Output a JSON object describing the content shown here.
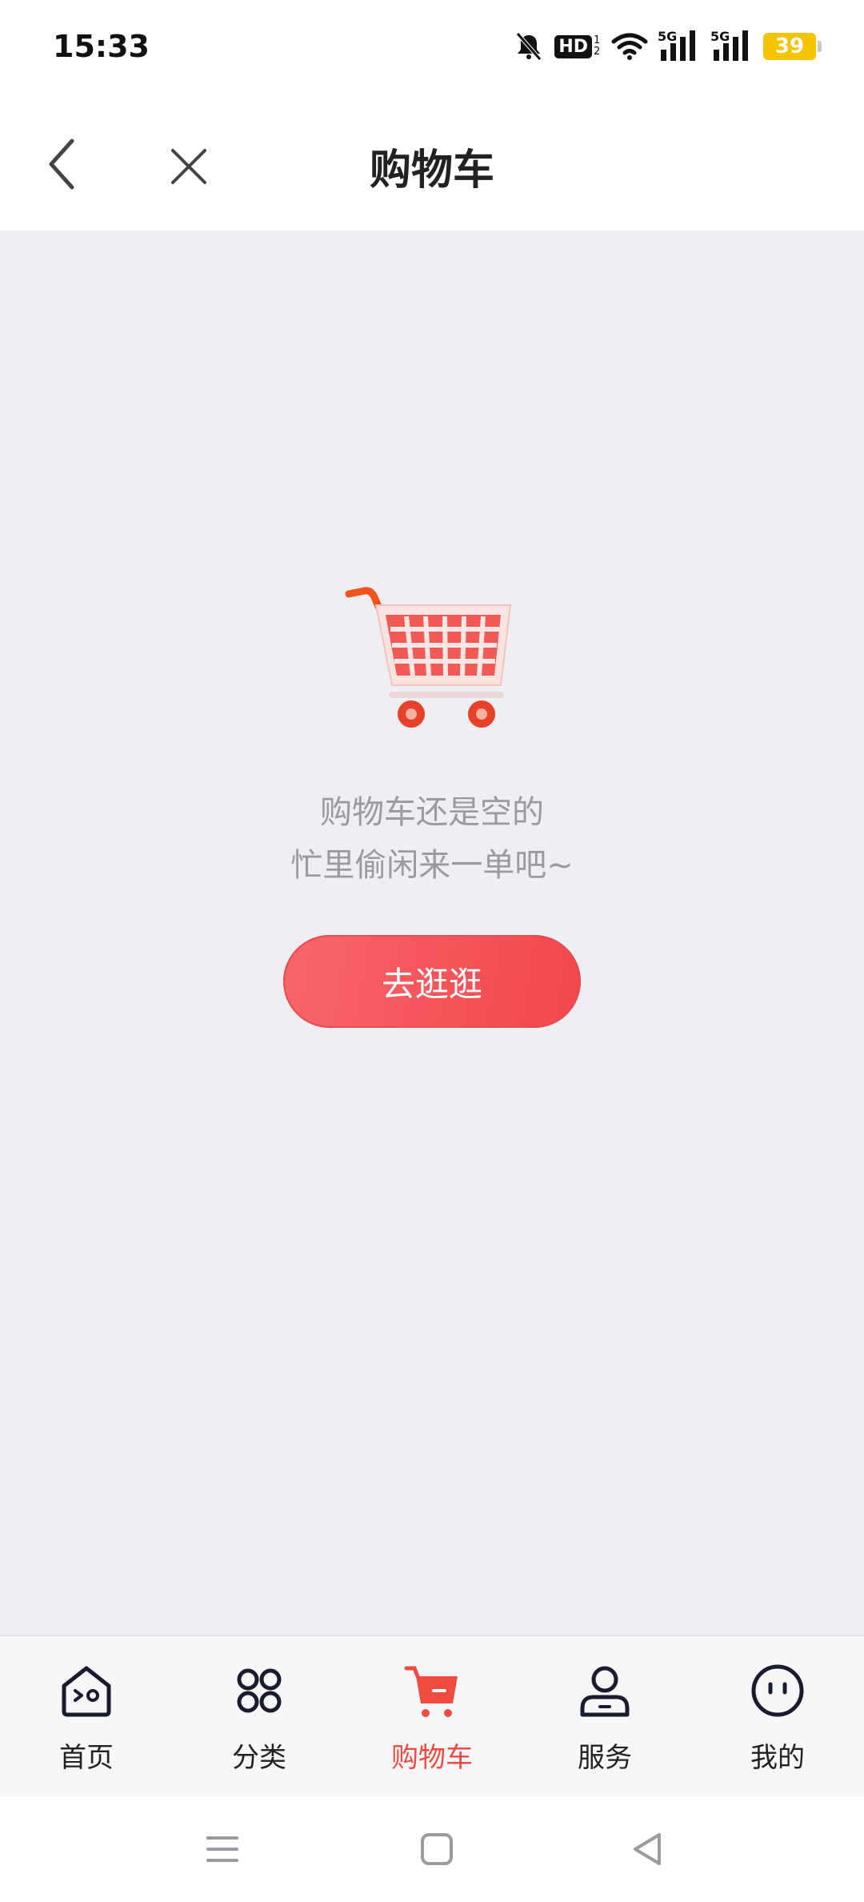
{
  "status_bar": {
    "time": "15:33",
    "icons": [
      "bell-muted-icon",
      "hd-icon",
      "wifi-icon",
      "5g-signal-icon",
      "5g-signal-icon"
    ],
    "hd_label": "HD",
    "hd_sub": "1 2",
    "network_label": "5G",
    "battery": "39",
    "battery_color": "#f4c400"
  },
  "header": {
    "title": "购物车",
    "back_icon": "chevron-left-icon",
    "close_icon": "close-icon"
  },
  "empty_state": {
    "illustration": "shopping-cart-icon",
    "line1": "购物车还是空的",
    "line2": "忙里偷闲来一单吧~",
    "button_label": "去逛逛",
    "accent_color": "#f0474d"
  },
  "tabbar": {
    "active_color": "#ef4b41",
    "items": [
      {
        "label": "首页",
        "icon": "home-icon",
        "active": false
      },
      {
        "label": "分类",
        "icon": "category-icon",
        "active": false
      },
      {
        "label": "购物车",
        "icon": "cart-icon",
        "active": true
      },
      {
        "label": "服务",
        "icon": "user-icon",
        "active": false
      },
      {
        "label": "我的",
        "icon": "face-icon",
        "active": false
      }
    ]
  },
  "system_nav": {
    "items": [
      "menu-icon",
      "home-square-icon",
      "back-triangle-icon"
    ]
  }
}
